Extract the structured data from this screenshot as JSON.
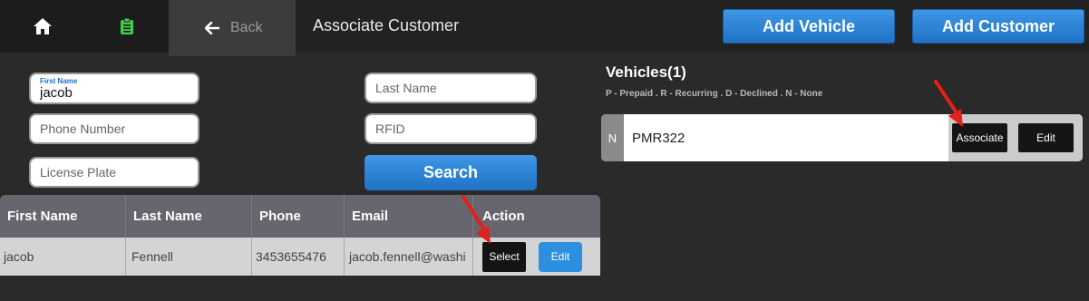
{
  "header": {
    "home_icon": "home-icon",
    "tasks_icon": "clipboard-icon",
    "back_label": "Back",
    "title": "Associate Customer",
    "add_vehicle_label": "Add Vehicle",
    "add_customer_label": "Add Customer"
  },
  "search": {
    "first_name_label": "First Name",
    "first_name_value": "jacob",
    "last_name_placeholder": "Last Name",
    "phone_placeholder": "Phone Number",
    "rfid_placeholder": "RFID",
    "plate_placeholder": "License Plate",
    "search_label": "Search"
  },
  "table": {
    "headers": [
      "First Name",
      "Last Name",
      "Phone",
      "Email",
      "Action"
    ],
    "rows": [
      {
        "first_name": "jacob",
        "last_name": "Fennell",
        "phone": "3453655476",
        "email": "jacob.fennell@washi",
        "select_label": "Select",
        "edit_label": "Edit"
      }
    ]
  },
  "vehicles": {
    "title": "Vehicles(1)",
    "legend": "P - Prepaid . R - Recurring . D - Declined . N - None",
    "items": [
      {
        "type": "N",
        "plate": "PMR322",
        "associate_label": "Associate",
        "edit_label": "Edit"
      }
    ]
  },
  "colors": {
    "accent_blue": "#2d8fe0",
    "annotation_arrow": "#e3201b",
    "task_icon_green": "#3fcf4a"
  }
}
